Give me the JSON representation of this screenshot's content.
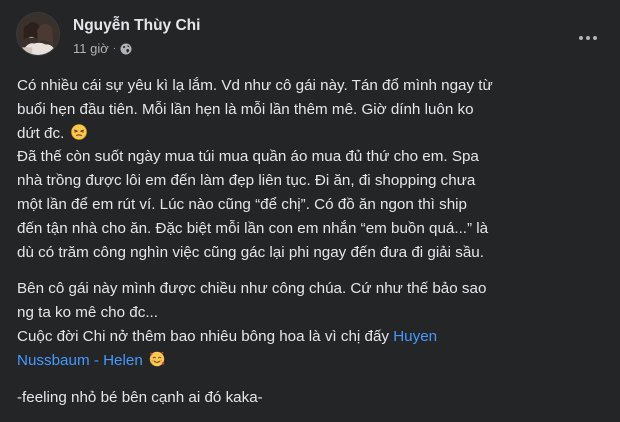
{
  "post": {
    "author_name": "Nguyễn Thùy Chi",
    "timestamp": "11 giờ",
    "separator": "·",
    "privacy_icon": "globe-icon",
    "more_icon": "more-options-icon",
    "paragraph1": {
      "line1": "Có nhiều cái sự yêu kì lạ lắm. Vd như cô gái này. Tán đổ mình ngay từ",
      "line2": "buổi hẹn đầu tiên. Mỗi lần hẹn là mỗi lần thêm mê. Giờ dính luôn ko",
      "line3": "dứt đc.",
      "line3_emoji": "persevering-face-emoji",
      "line4": "Đã thế còn suốt ngày mua túi mua quần áo mua đủ thứ cho em. Spa",
      "line5": "nhà trồng được lôi em đến làm đẹp liên tục. Đi ăn, đi shopping chưa",
      "line6": "một lần để em rút ví. Lúc nào cũng “để chị”. Có đồ ăn ngon thì ship",
      "line7": "đến tận nhà cho ăn. Đặc biệt mỗi lần con em nhắn “em buồn quá...” là",
      "line8": "dù có trăm công nghìn việc cũng gác lại phi ngay đến đưa đi giải sầu."
    },
    "paragraph2": {
      "line1": "Bên cô gái này mình được chiều như công chúa. Cứ như thế bảo sao",
      "line2": "ng ta ko mê cho đc...",
      "line3_prefix": "Cuộc đời Chi nở thêm bao nhiêu bông hoa là vì chị đấy ",
      "line3_link": "Huyen",
      "line4_link": "Nussbaum - Helen",
      "line4_emoji": "smiling-face-with-hearts-emoji"
    },
    "paragraph3": {
      "line1": "-feeling nhỏ bé bên cạnh ai đó kaka-"
    }
  }
}
